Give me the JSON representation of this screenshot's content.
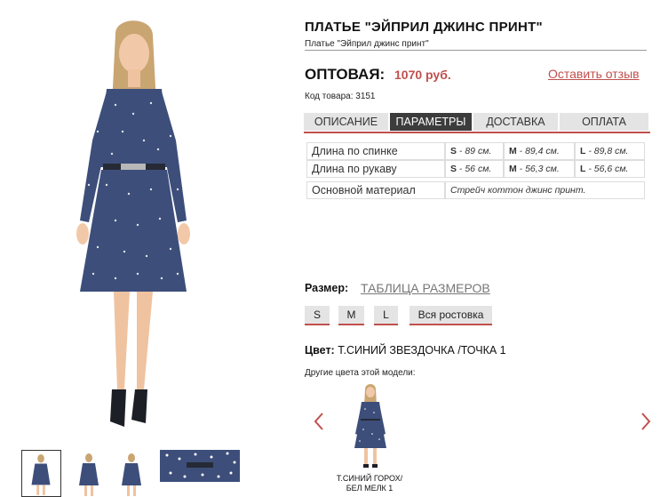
{
  "product": {
    "title": "ПЛАТЬЕ \"ЭЙПРИЛ ДЖИНС ПРИНТ\"",
    "subtitle": "Платье \"Эйприл джинс принт\"",
    "price_label": "ОПТОВАЯ:",
    "price_value": "1070 руб.",
    "review_link": "Оставить отзыв",
    "sku": "Код товара: 3151"
  },
  "tabs": [
    {
      "label": "ОПИСАНИЕ",
      "active": false
    },
    {
      "label": "ПАРАМЕТРЫ",
      "active": true
    },
    {
      "label": "ДОСТАВКА",
      "active": false
    },
    {
      "label": "ОПЛАТА",
      "active": false
    }
  ],
  "params": {
    "rows": [
      {
        "label": "Длина по спинке",
        "s": {
          "size": "S",
          "value": " - 89 см."
        },
        "m": {
          "size": "M",
          "value": " - 89,4 см."
        },
        "l": {
          "size": "L",
          "value": " - 89,8 см."
        }
      },
      {
        "label": "Длина по рукаву",
        "s": {
          "size": "S",
          "value": " - 56 см."
        },
        "m": {
          "size": "M",
          "value": " - 56,3 см."
        },
        "l": {
          "size": "L",
          "value": " - 56,6 см."
        }
      }
    ],
    "material_label": "Основной материал",
    "material_value": "Стрейч коттон джинс принт."
  },
  "size": {
    "label": "Размер:",
    "table_link": "ТАБЛИЦА РАЗМЕРОВ",
    "options": [
      "S",
      "M",
      "L",
      "Вся ростовка"
    ]
  },
  "color": {
    "label": "Цвет:",
    "value": "Т.СИНИЙ ЗВЕЗДОЧКА /ТОЧКА 1",
    "other_label": "Другие цвета этой модели:",
    "variants": [
      {
        "caption_line1": "Т.СИНИЙ ГОРОХ/",
        "caption_line2": "БЕЛ МЕЛК 1"
      }
    ]
  },
  "colors": {
    "accent": "#c0504d",
    "tab_active": "#3c3c3c",
    "tab_inactive": "#e4e4e4",
    "dress": "#3d4e7a"
  },
  "icons": {
    "prev": "chevron-left-icon",
    "next": "chevron-right-icon"
  }
}
